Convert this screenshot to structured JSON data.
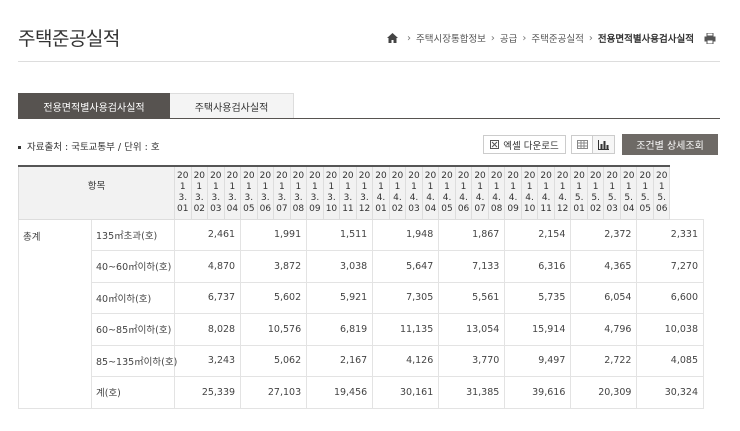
{
  "page": {
    "title": "주택준공실적"
  },
  "breadcrumb": {
    "items": [
      "주택시장통합정보",
      "공급",
      "주택준공실적"
    ],
    "current": "전용면적별사용검사실적"
  },
  "tabs": [
    {
      "label": "전용면적별사용검사실적",
      "active": true
    },
    {
      "label": "주택사용검사실적",
      "active": false
    }
  ],
  "source_text": "자료출처 : 국토교통부 / 단위 : 호",
  "buttons": {
    "excel": "엑셀 다운로드",
    "search": "조건별 상세조회"
  },
  "icons": {
    "home": "home-icon",
    "print": "printer-icon",
    "excel": "excel-icon",
    "grid": "grid-view-icon",
    "chart": "bar-chart-icon"
  },
  "table": {
    "item_header": "항목",
    "periods": [
      [
        "20",
        "1",
        "3.",
        "01"
      ],
      [
        "20",
        "1",
        "3.",
        "02"
      ],
      [
        "20",
        "1",
        "3.",
        "03"
      ],
      [
        "20",
        "1",
        "3.",
        "04"
      ],
      [
        "20",
        "1",
        "3.",
        "05"
      ],
      [
        "20",
        "1",
        "3.",
        "06"
      ],
      [
        "20",
        "1",
        "3.",
        "07"
      ],
      [
        "20",
        "1",
        "3.",
        "08"
      ],
      [
        "20",
        "1",
        "3.",
        "09"
      ],
      [
        "20",
        "1",
        "3.",
        "10"
      ],
      [
        "20",
        "1",
        "3.",
        "11"
      ],
      [
        "20",
        "1",
        "3.",
        "12"
      ],
      [
        "20",
        "1",
        "4.",
        "01"
      ],
      [
        "20",
        "1",
        "4.",
        "02"
      ],
      [
        "20",
        "1",
        "4.",
        "03"
      ],
      [
        "20",
        "1",
        "4.",
        "04"
      ],
      [
        "20",
        "1",
        "4.",
        "05"
      ],
      [
        "20",
        "1",
        "4.",
        "06"
      ],
      [
        "20",
        "1",
        "4.",
        "07"
      ],
      [
        "20",
        "1",
        "4.",
        "08"
      ],
      [
        "20",
        "1",
        "4.",
        "09"
      ],
      [
        "20",
        "1",
        "4.",
        "10"
      ],
      [
        "20",
        "1",
        "4.",
        "11"
      ],
      [
        "20",
        "1",
        "4.",
        "12"
      ],
      [
        "20",
        "1",
        "5.",
        "01"
      ],
      [
        "20",
        "1",
        "5.",
        "02"
      ],
      [
        "20",
        "1",
        "5.",
        "03"
      ],
      [
        "20",
        "1",
        "5.",
        "04"
      ],
      [
        "20",
        "1",
        "5.",
        "05"
      ],
      [
        "20",
        "1",
        "5.",
        "06"
      ]
    ],
    "group_label": "총계",
    "rows": [
      {
        "label": "135㎡초과(호)",
        "values": [
          "2,461",
          "1,991",
          "1,511",
          "1,948",
          "1,867",
          "2,154",
          "2,372",
          "2,331"
        ]
      },
      {
        "label": "40~60㎡이하(호)",
        "values": [
          "4,870",
          "3,872",
          "3,038",
          "5,647",
          "7,133",
          "6,316",
          "4,365",
          "7,270"
        ]
      },
      {
        "label": "40㎡이하(호)",
        "values": [
          "6,737",
          "5,602",
          "5,921",
          "7,305",
          "5,561",
          "5,735",
          "6,054",
          "6,600"
        ]
      },
      {
        "label": "60~85㎡이하(호)",
        "values": [
          "8,028",
          "10,576",
          "6,819",
          "11,135",
          "13,054",
          "15,914",
          "4,796",
          "10,038"
        ]
      },
      {
        "label": "85~135㎡이하(호)",
        "values": [
          "3,243",
          "5,062",
          "2,167",
          "4,126",
          "3,770",
          "9,497",
          "2,722",
          "4,085"
        ]
      },
      {
        "label": "계(호)",
        "values": [
          "25,339",
          "27,103",
          "19,456",
          "30,161",
          "31,385",
          "39,616",
          "20,309",
          "30,324"
        ]
      }
    ]
  },
  "colors": {
    "active_tab": "#575350",
    "search_button": "#6e6a66",
    "header_bg": "#f2f2f2"
  }
}
